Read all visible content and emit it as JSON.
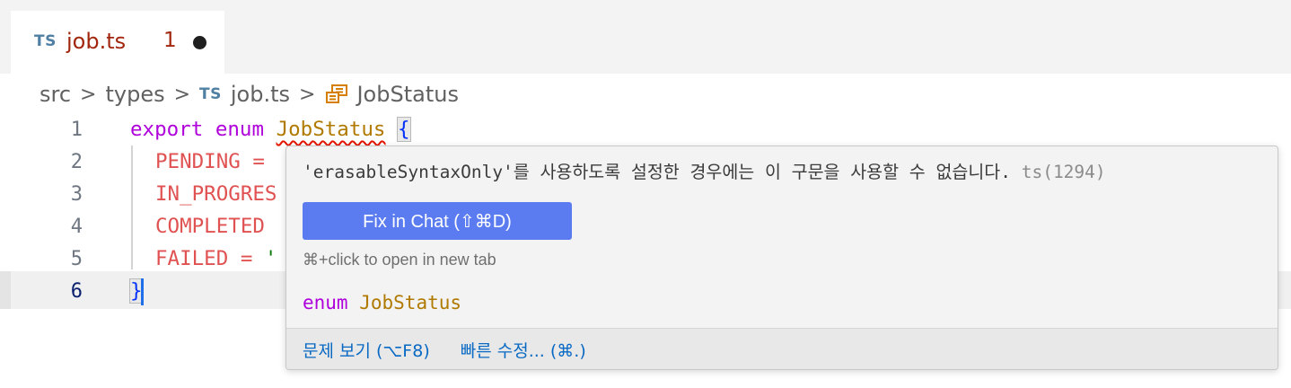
{
  "tab": {
    "lang_badge": "TS",
    "filename": "job.ts",
    "problem_count": "1"
  },
  "breadcrumb": {
    "items": [
      "src",
      "types",
      "job.ts",
      "JobStatus"
    ],
    "lang_badge": "TS",
    "separator": ">"
  },
  "editor": {
    "line_numbers": [
      "1",
      "2",
      "3",
      "4",
      "5",
      "6"
    ],
    "lines": {
      "l1_export": "export",
      "l1_enum": "enum",
      "l1_name": "JobStatus",
      "l1_brace": "{",
      "l2": "PENDING =",
      "l3": "IN_PROGRES",
      "l4": "COMPLETED",
      "l5_name": "FAILED =",
      "l5_quote": "'",
      "l6_brace": "}"
    }
  },
  "hover": {
    "message": "'erasableSyntaxOnly'를 사용하도록 설정한 경우에는 이 구문을 사용할 수 없습니다.",
    "error_code": "ts(1294)",
    "fix_button": "Fix in Chat (⇧⌘D)",
    "hint": "⌘+click to open in new tab",
    "signature_keyword": "enum",
    "signature_name": "JobStatus",
    "footer_links": [
      "문제 보기 (⌥F8)",
      "빠른 수정... (⌘.)"
    ]
  },
  "colors": {
    "keyword": "#af00db",
    "type": "#b07a00",
    "member": "#e05252",
    "error": "#e51400",
    "button": "#5b7cf0",
    "link": "#0969c3"
  }
}
